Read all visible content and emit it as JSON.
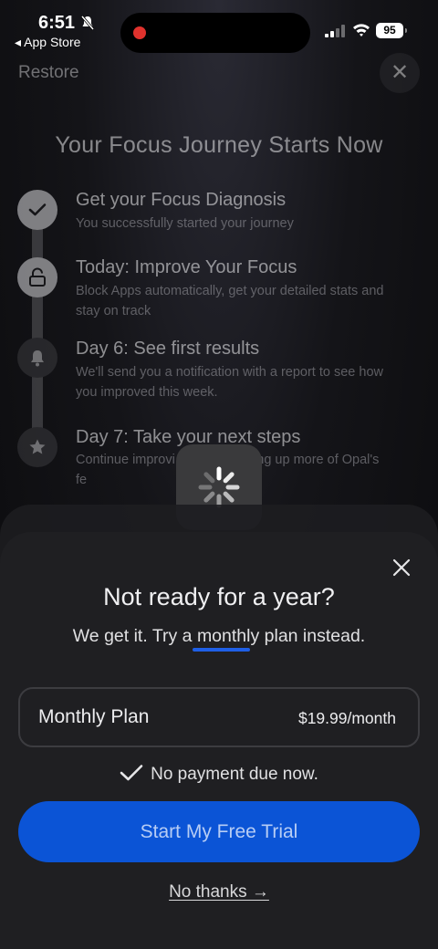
{
  "status_bar": {
    "time": "6:51",
    "back_label": "◂ App Store",
    "battery": "95"
  },
  "background_page": {
    "restore_label": "Restore",
    "close_glyph": "✕",
    "title": "Your Focus Journey Starts Now",
    "steps": [
      {
        "title": "Get your Focus Diagnosis",
        "desc": "You successfully started your journey",
        "icon": "check-icon"
      },
      {
        "title": "Today: Improve Your Focus",
        "desc": "Block Apps automatically, get your detailed stats and stay on track",
        "icon": "lock-icon"
      },
      {
        "title": "Day 6: See first results",
        "desc": "We'll send you a notification with a report to see how you improved this week.",
        "icon": "bell-icon"
      },
      {
        "title": "Day 7: Take your next steps",
        "desc": "Continue improvi                  ntime by setting up more of Opal's fe",
        "icon": "star-icon"
      }
    ]
  },
  "sheet": {
    "title": "Not ready for a year?",
    "subtitle_pre": "We get it. Try a ",
    "subtitle_highlight": "monthly",
    "subtitle_post": " plan instead.",
    "plan_name": "Monthly Plan",
    "plan_price": "$19.99/month",
    "no_payment": "No payment due now.",
    "cta_label": "Start My Free Trial",
    "no_thanks": "No thanks →"
  },
  "colors": {
    "accent": "#0b54d6",
    "underline": "#1f5fe6",
    "sheet_bg": "#1f1f22"
  }
}
